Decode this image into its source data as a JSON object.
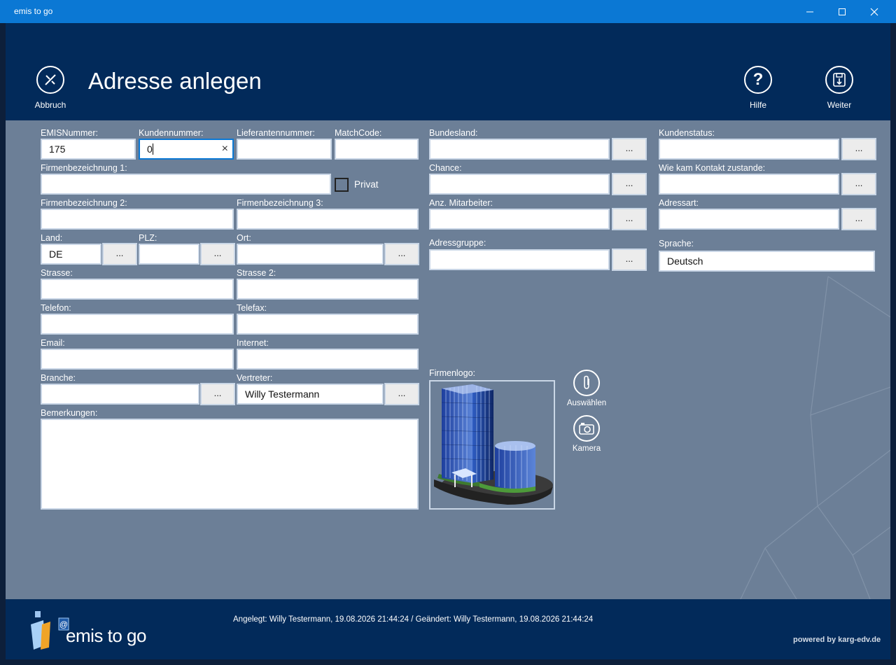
{
  "window": {
    "title": "emis to go"
  },
  "header": {
    "page_title": "Adresse anlegen",
    "cancel_label": "Abbruch",
    "help_label": "Hilfe",
    "next_label": "Weiter"
  },
  "form": {
    "emis_nummer": {
      "label": "EMISNummer:",
      "value": "175"
    },
    "kundennummer": {
      "label": "Kundennummer:",
      "value": "0"
    },
    "lieferantennummer": {
      "label": "Lieferantennummer:",
      "value": ""
    },
    "matchcode": {
      "label": "MatchCode:",
      "value": ""
    },
    "firmenbezeichnung1": {
      "label": "Firmenbezeichnung 1:",
      "value": ""
    },
    "privat": {
      "label": "Privat",
      "checked": false
    },
    "firmenbezeichnung2": {
      "label": "Firmenbezeichnung 2:",
      "value": ""
    },
    "firmenbezeichnung3": {
      "label": "Firmenbezeichnung 3:",
      "value": ""
    },
    "land": {
      "label": "Land:",
      "value": "DE"
    },
    "plz": {
      "label": "PLZ:",
      "value": ""
    },
    "ort": {
      "label": "Ort:",
      "value": ""
    },
    "strasse": {
      "label": "Strasse:",
      "value": ""
    },
    "strasse2": {
      "label": "Strasse 2:",
      "value": ""
    },
    "telefon": {
      "label": "Telefon:",
      "value": ""
    },
    "telefax": {
      "label": "Telefax:",
      "value": ""
    },
    "email": {
      "label": "Email:",
      "value": ""
    },
    "internet": {
      "label": "Internet:",
      "value": ""
    },
    "branche": {
      "label": "Branche:",
      "value": ""
    },
    "vertreter": {
      "label": "Vertreter:",
      "value": "Willy Testermann"
    },
    "bemerkungen": {
      "label": "Bemerkungen:",
      "value": ""
    },
    "bundesland": {
      "label": "Bundesland:",
      "value": ""
    },
    "chance": {
      "label": "Chance:",
      "value": ""
    },
    "anz_mitarbeiter": {
      "label": "Anz. Mitarbeiter:",
      "value": ""
    },
    "adressgruppe": {
      "label": "Adressgruppe:",
      "value": ""
    },
    "kundenstatus": {
      "label": "Kundenstatus:",
      "value": ""
    },
    "kontakt": {
      "label": "Wie kam Kontakt zustande:",
      "value": ""
    },
    "adressart": {
      "label": "Adressart:",
      "value": ""
    },
    "sprache": {
      "label": "Sprache:",
      "value": "Deutsch"
    },
    "browse_label": "..."
  },
  "logo": {
    "label": "Firmenlogo:",
    "select_label": "Auswählen",
    "camera_label": "Kamera"
  },
  "footer": {
    "info": "Angelegt: Willy Testermann, 19.08.2026 21:44:24  /  Geändert: Willy Testermann, 19.08.2026 21:44:24",
    "brand": "emis to go",
    "powered": "powered by karg-edv.de"
  }
}
